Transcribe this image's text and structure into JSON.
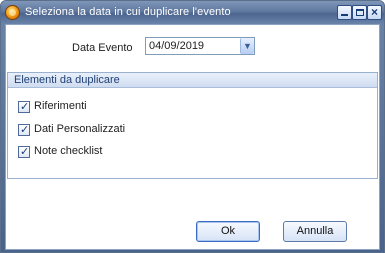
{
  "window": {
    "title": "Seleziona la data in cui duplicare l'evento",
    "controls": {
      "minimize": "minimize-icon",
      "maximize": "maximize-icon",
      "close": "close-icon"
    }
  },
  "form": {
    "date_label": "Data Evento",
    "date_value": "04/09/2019"
  },
  "group": {
    "title": "Elementi da duplicare",
    "items": [
      {
        "label": "Riferimenti",
        "checked": true
      },
      {
        "label": "Dati Personalizzati",
        "checked": true
      },
      {
        "label": "Note checklist",
        "checked": true
      }
    ]
  },
  "buttons": {
    "ok": "Ok",
    "cancel": "Annulla"
  },
  "colors": {
    "titlebar": "#5f789e",
    "group_header": "#cfdcf0",
    "accent": "#1f3f73"
  }
}
